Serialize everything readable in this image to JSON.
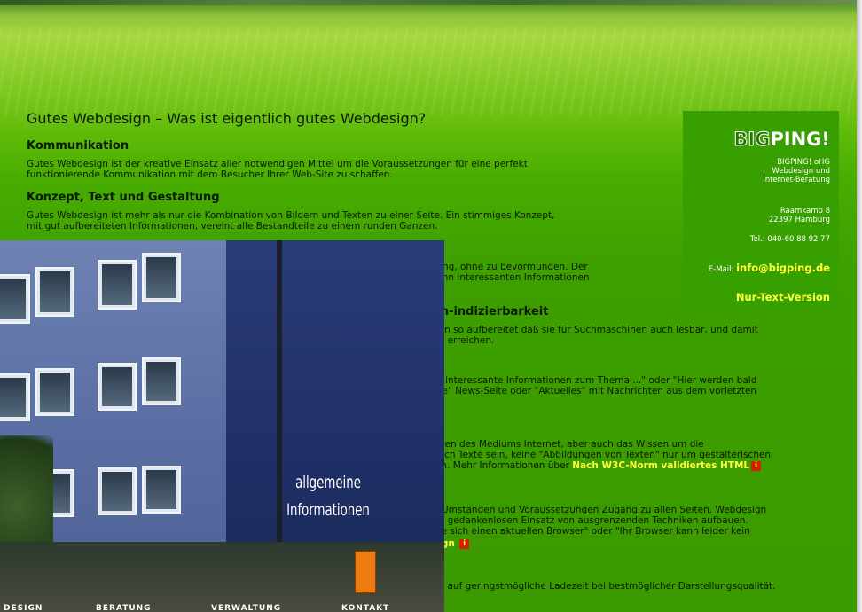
{
  "title": "Gutes Webdesign – Was ist eigentlich gutes Webdesign?",
  "sections": [
    {
      "heading": "Kommunikation",
      "lines": [
        "Gutes Webdesign ist der kreative Einsatz aller notwendigen Mittel um die Voraussetzungen für eine perfekt",
        "funktionierende Kommunikation mit dem Besucher Ihrer Web-Site zu schaffen."
      ]
    },
    {
      "heading": "Konzept, Text und Gestaltung",
      "lines": [
        "Gutes Webdesign ist mehr als nur die Kombination von Bildern und Texten zu einer Seite. Ein stimmiges Konzept,",
        "mit gut aufbereiteten Informationen, vereint alle Bestandteile zu einem runden Ganzen."
      ]
    }
  ],
  "partial": {
    "p3_l1": "rung, ohne zu bevormunden. Der",
    "p3_l2": "r Ihn interessanten Informationen",
    "h4": "en-indizierbarkeit",
    "p4_l1": "den so aufbereitet daß sie für Suchmaschinen auch lesbar, und damit",
    "p4_l2": "en erreichen.",
    "p5_l1": "er interessante Informationen zum Thema ...\" oder \"Hier werden bald",
    "p5_l2": "ere\" News-Seite oder \"Aktuelles\" mit Nachrichten aus dem vorletzten",
    "p6_l1": "eiten des Mediums Internet, aber auch das Wissen um die",
    "p6_l2": "auch Texte sein, keine \"Abbildungen von Texten\" nur um gestalterischen",
    "p6_l3": "ein. Mehr Informationen über",
    "p6_link": "Nach W3C-Norm validiertes HTML",
    "p7_l1": "n Umständen und Voraussetzungen Zugang zu allen Seiten. Webdesign",
    "p7_l2": "nd gedankenlosen Einsatz von ausgrenzenden Techniken aufbauen.",
    "p7_l3": "Sie sich einen aktuellen Browser\" oder \"Ihr Browser kann leider kein",
    "p7_link": "sign",
    "p8_l1": "en auf geringstmögliche Ladezeit bei bestmöglicher Darstellungsqualität."
  },
  "info_icon": "i",
  "sidebar": {
    "logo_big": "BIG",
    "logo_ping": "PING",
    "logo_bang": "!",
    "company": "BIGPING! oHG",
    "tagline1": "Webdesign und",
    "tagline2": "Internet-Beratung",
    "street": "Raamkamp 8",
    "city": "22397 Hamburg",
    "phone": "Tel.: 040-60 88 92 77",
    "email_label": "E-Mail:",
    "email": "info@bigping.de",
    "text_version": "Nur-Text-Version"
  },
  "photo": {
    "caption_line1": "allgemeine",
    "caption_line2": "Informationen",
    "nav": [
      "DESIGN",
      "BERATUNG",
      "VERWALTUNG",
      "KONTAKT"
    ]
  }
}
